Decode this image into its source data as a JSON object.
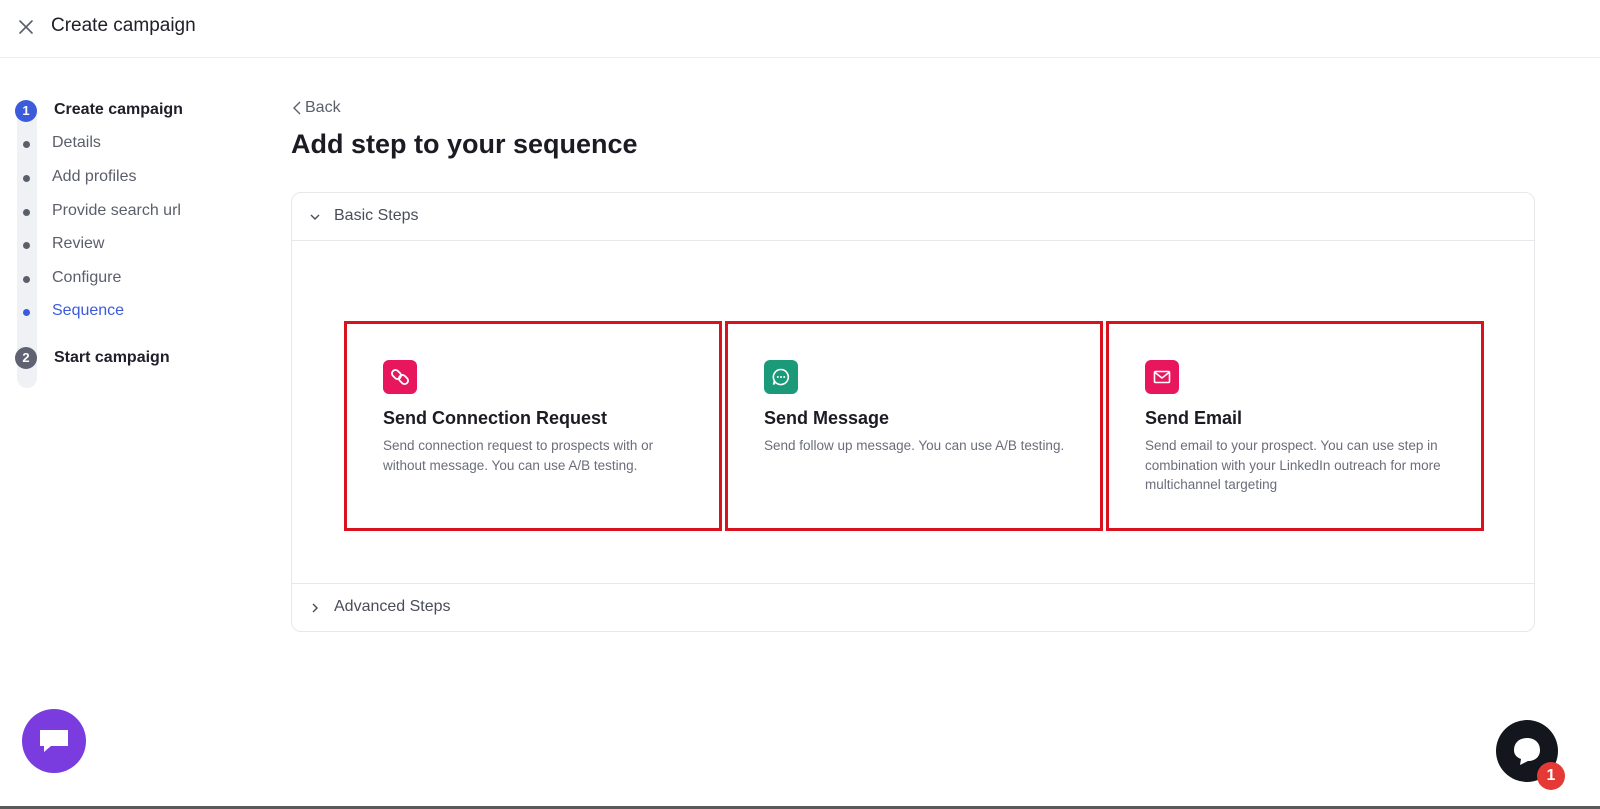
{
  "header": {
    "title": "Create campaign"
  },
  "stepper": {
    "step1": {
      "number": "1",
      "title": "Create campaign"
    },
    "substeps": [
      {
        "label": "Details"
      },
      {
        "label": "Add profiles"
      },
      {
        "label": "Provide search url"
      },
      {
        "label": "Review"
      },
      {
        "label": "Configure"
      },
      {
        "label": "Sequence"
      }
    ],
    "current_substep": "Sequence",
    "step2": {
      "number": "2",
      "title": "Start campaign"
    }
  },
  "main": {
    "back_label": "Back",
    "title": "Add step to your sequence",
    "basic_section": {
      "label": "Basic Steps"
    },
    "advanced_section": {
      "label": "Advanced Steps"
    },
    "cards": [
      {
        "title": "Send Connection Request",
        "description": "Send connection request to prospects with or without message. You can use A/B testing.",
        "icon": "link-icon",
        "color": "#e8175d"
      },
      {
        "title": "Send Message",
        "description": "Send follow up message. You can use A/B testing.",
        "icon": "chat-bubble-icon",
        "color": "#1a9a78"
      },
      {
        "title": "Send Email",
        "description": "Send email to your prospect. You can use step in combination with your LinkedIn outreach for more multichannel targeting",
        "icon": "envelope-icon",
        "color": "#e8175d"
      }
    ]
  },
  "help_widget": {
    "badge_count": "1"
  },
  "colors": {
    "accent": "#3b5bdb",
    "highlight_border": "#d9121f",
    "chat_fab": "#7a3bdf"
  }
}
